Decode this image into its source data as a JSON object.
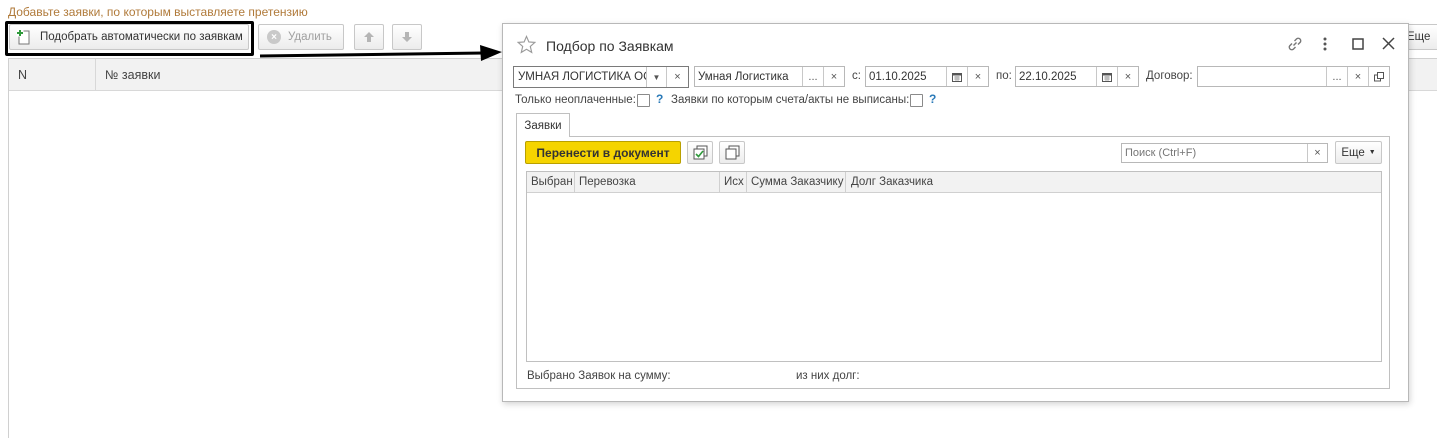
{
  "main": {
    "top_link": "Добавьте заявки, по которым выставляете претензию",
    "toolbar": {
      "autopick_label": "Подобрать автоматически по заявкам",
      "delete_label": "Удалить",
      "more_label": "Еще"
    },
    "table": {
      "columns": [
        "N",
        "№ заявки"
      ]
    }
  },
  "dialog": {
    "title": "Подбор по Заявкам",
    "filters": {
      "org_value": "УМНАЯ ЛОГИСТИКА ОС",
      "counterparty_value": "Умная Логистика",
      "from_label": "с:",
      "from_value": "01.10.2025",
      "to_label": "по:",
      "to_value": "22.10.2025",
      "contract_label": "Договор:",
      "contract_value": "",
      "unpaid_label": "Только неоплаченные:",
      "no_invoice_label": "Заявки по которым счета/акты не выписаны:",
      "help_mark": "?"
    },
    "tab_label": "Заявки",
    "transfer_label": "Перенести в документ",
    "search_placeholder": "Поиск (Ctrl+F)",
    "more_label": "Еще",
    "table": {
      "columns": [
        "Выбран",
        "Перевозка",
        "Исх",
        "Сумма Заказчику",
        "Долг Заказчика"
      ]
    },
    "footer": {
      "selected_sum_label": "Выбрано Заявок на сумму:",
      "debt_label": "из них долг:"
    }
  },
  "colors": {
    "link": "#b07a3a",
    "accent_yellow": "#f5d400",
    "help": "#2a7ab8"
  }
}
